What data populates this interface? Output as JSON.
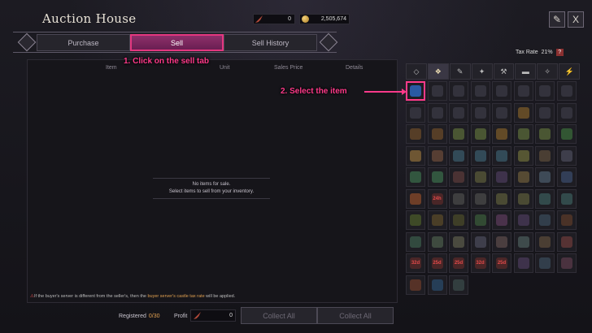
{
  "window": {
    "title": "Auction House"
  },
  "currency": {
    "feather_amount": "0",
    "gold_amount": "2,505,674"
  },
  "top_buttons": {
    "book_icon": "book-icon",
    "close_icon": "close-icon",
    "close_label": "X"
  },
  "tabs": [
    {
      "label": "Purchase",
      "active": false
    },
    {
      "label": "Sell",
      "active": true
    },
    {
      "label": "Sell History",
      "active": false
    }
  ],
  "tax": {
    "label": "Tax Rate",
    "value": "21%",
    "help": "?"
  },
  "columns": {
    "item": "Item",
    "unit": "Unit",
    "sales_price": "Sales Price",
    "details": "Details"
  },
  "empty_state": {
    "line1": "No items for sale.",
    "line2": "Select items to sell from your inventory."
  },
  "notice": {
    "prefix": "If the buyer's server is different from the seller's, then the ",
    "highlight": "buyer server's castle tax rate",
    "suffix": " will be applied."
  },
  "footer": {
    "registered_label": "Registered",
    "registered_count": "0/30",
    "profit_label": "Profit",
    "profit_value": "0",
    "collect_all_1": "Collect All",
    "collect_all_2": "Collect All"
  },
  "annotations": {
    "step1": "1. Click on the sell tab",
    "step2": "2. Select the item"
  },
  "inventory": {
    "tabs": [
      "◇",
      "❖",
      "✎",
      "✦",
      "⚒",
      "▬",
      "✧",
      "⚡"
    ],
    "active_tab": 1,
    "slots": [
      {
        "badge": "",
        "color": "#2e6fcf",
        "selected": true
      },
      {
        "badge": "",
        "color": "#3b3a45"
      },
      {
        "badge": "",
        "color": "#3b3a45"
      },
      {
        "badge": "",
        "color": "#3b3a45"
      },
      {
        "badge": "",
        "color": "#3b3a45"
      },
      {
        "badge": "",
        "color": "#3b3a45"
      },
      {
        "badge": "",
        "color": "#3b3a45"
      },
      {
        "badge": "",
        "color": "#3b3a45"
      },
      {
        "badge": "",
        "color": "#3b3a45"
      },
      {
        "badge": "",
        "color": "#3b3a45"
      },
      {
        "badge": "",
        "color": "#3b3a45"
      },
      {
        "badge": "",
        "color": "#3b3a45"
      },
      {
        "badge": "",
        "color": "#3b3a45"
      },
      {
        "badge": "",
        "color": "#7a5a2a"
      },
      {
        "badge": "",
        "color": "#3b3a45"
      },
      {
        "badge": "",
        "color": "#3b3a45"
      },
      {
        "badge": "",
        "color": "#6a4a2a"
      },
      {
        "badge": "",
        "color": "#6a4a2a"
      },
      {
        "badge": "",
        "color": "#5a6a3a"
      },
      {
        "badge": "",
        "color": "#5a6a3a"
      },
      {
        "badge": "",
        "color": "#7a5a2a"
      },
      {
        "badge": "",
        "color": "#5a6a3a"
      },
      {
        "badge": "",
        "color": "#5a6a3a"
      },
      {
        "badge": "",
        "color": "#3a6a3a"
      },
      {
        "badge": "",
        "color": "#8a6a3a"
      },
      {
        "badge": "",
        "color": "#6a4a3a"
      },
      {
        "badge": "",
        "color": "#3a5a6a"
      },
      {
        "badge": "",
        "color": "#3a5a6a"
      },
      {
        "badge": "",
        "color": "#3a5a6a"
      },
      {
        "badge": "",
        "color": "#6a6a3a"
      },
      {
        "badge": "",
        "color": "#5a4a3a"
      },
      {
        "badge": "",
        "color": "#4a4a5a"
      },
      {
        "badge": "",
        "color": "#3a6a4a"
      },
      {
        "badge": "",
        "color": "#3a6a4a"
      },
      {
        "badge": "",
        "color": "#5a3a3a"
      },
      {
        "badge": "",
        "color": "#5a5a3a"
      },
      {
        "badge": "",
        "color": "#4a3a5a"
      },
      {
        "badge": "",
        "color": "#6a5a3a"
      },
      {
        "badge": "",
        "color": "#4a5a6a"
      },
      {
        "badge": "",
        "color": "#3a4a6a"
      },
      {
        "badge": "",
        "color": "#8a4a2a"
      },
      {
        "badge": "24h",
        "color": "#5a2a2a"
      },
      {
        "badge": "",
        "color": "#4a4a4a"
      },
      {
        "badge": "",
        "color": "#4a4a4a"
      },
      {
        "badge": "",
        "color": "#5a5a3a"
      },
      {
        "badge": "",
        "color": "#5a5a3a"
      },
      {
        "badge": "",
        "color": "#3a5a5a"
      },
      {
        "badge": "",
        "color": "#3a5a5a"
      },
      {
        "badge": "",
        "color": "#4a5a2a"
      },
      {
        "badge": "",
        "color": "#5a4a2a"
      },
      {
        "badge": "",
        "color": "#4a4a2a"
      },
      {
        "badge": "",
        "color": "#3a5a3a"
      },
      {
        "badge": "",
        "color": "#5a3a5a"
      },
      {
        "badge": "",
        "color": "#4a3a5a"
      },
      {
        "badge": "",
        "color": "#3a4a5a"
      },
      {
        "badge": "",
        "color": "#5a3a2a"
      },
      {
        "badge": "",
        "color": "#3a5a4a"
      },
      {
        "badge": "",
        "color": "#4a5a4a"
      },
      {
        "badge": "",
        "color": "#5a5a4a"
      },
      {
        "badge": "",
        "color": "#4a4a5a"
      },
      {
        "badge": "",
        "color": "#5a4a4a"
      },
      {
        "badge": "",
        "color": "#4a5a5a"
      },
      {
        "badge": "",
        "color": "#5a4a3a"
      },
      {
        "badge": "",
        "color": "#6a3a3a"
      },
      {
        "badge": "32d",
        "color": "#5a2a2a"
      },
      {
        "badge": "25d",
        "color": "#5a2a2a"
      },
      {
        "badge": "25d",
        "color": "#5a2a2a"
      },
      {
        "badge": "32d",
        "color": "#5a2a2a"
      },
      {
        "badge": "25d",
        "color": "#5a2a2a"
      },
      {
        "badge": "",
        "color": "#4a3a5a"
      },
      {
        "badge": "",
        "color": "#3a4a5a"
      },
      {
        "badge": "",
        "color": "#5a3a4a"
      },
      {
        "badge": "",
        "color": "#6a3a2a"
      },
      {
        "badge": "",
        "color": "#2a4a6a"
      },
      {
        "badge": "",
        "color": "#3a4a4a"
      }
    ]
  },
  "colors": {
    "accent": "#ff3a8a",
    "active_tab": "#8d2f6a",
    "badge_red": "#e24a4a",
    "highlight": "#e0a050"
  }
}
